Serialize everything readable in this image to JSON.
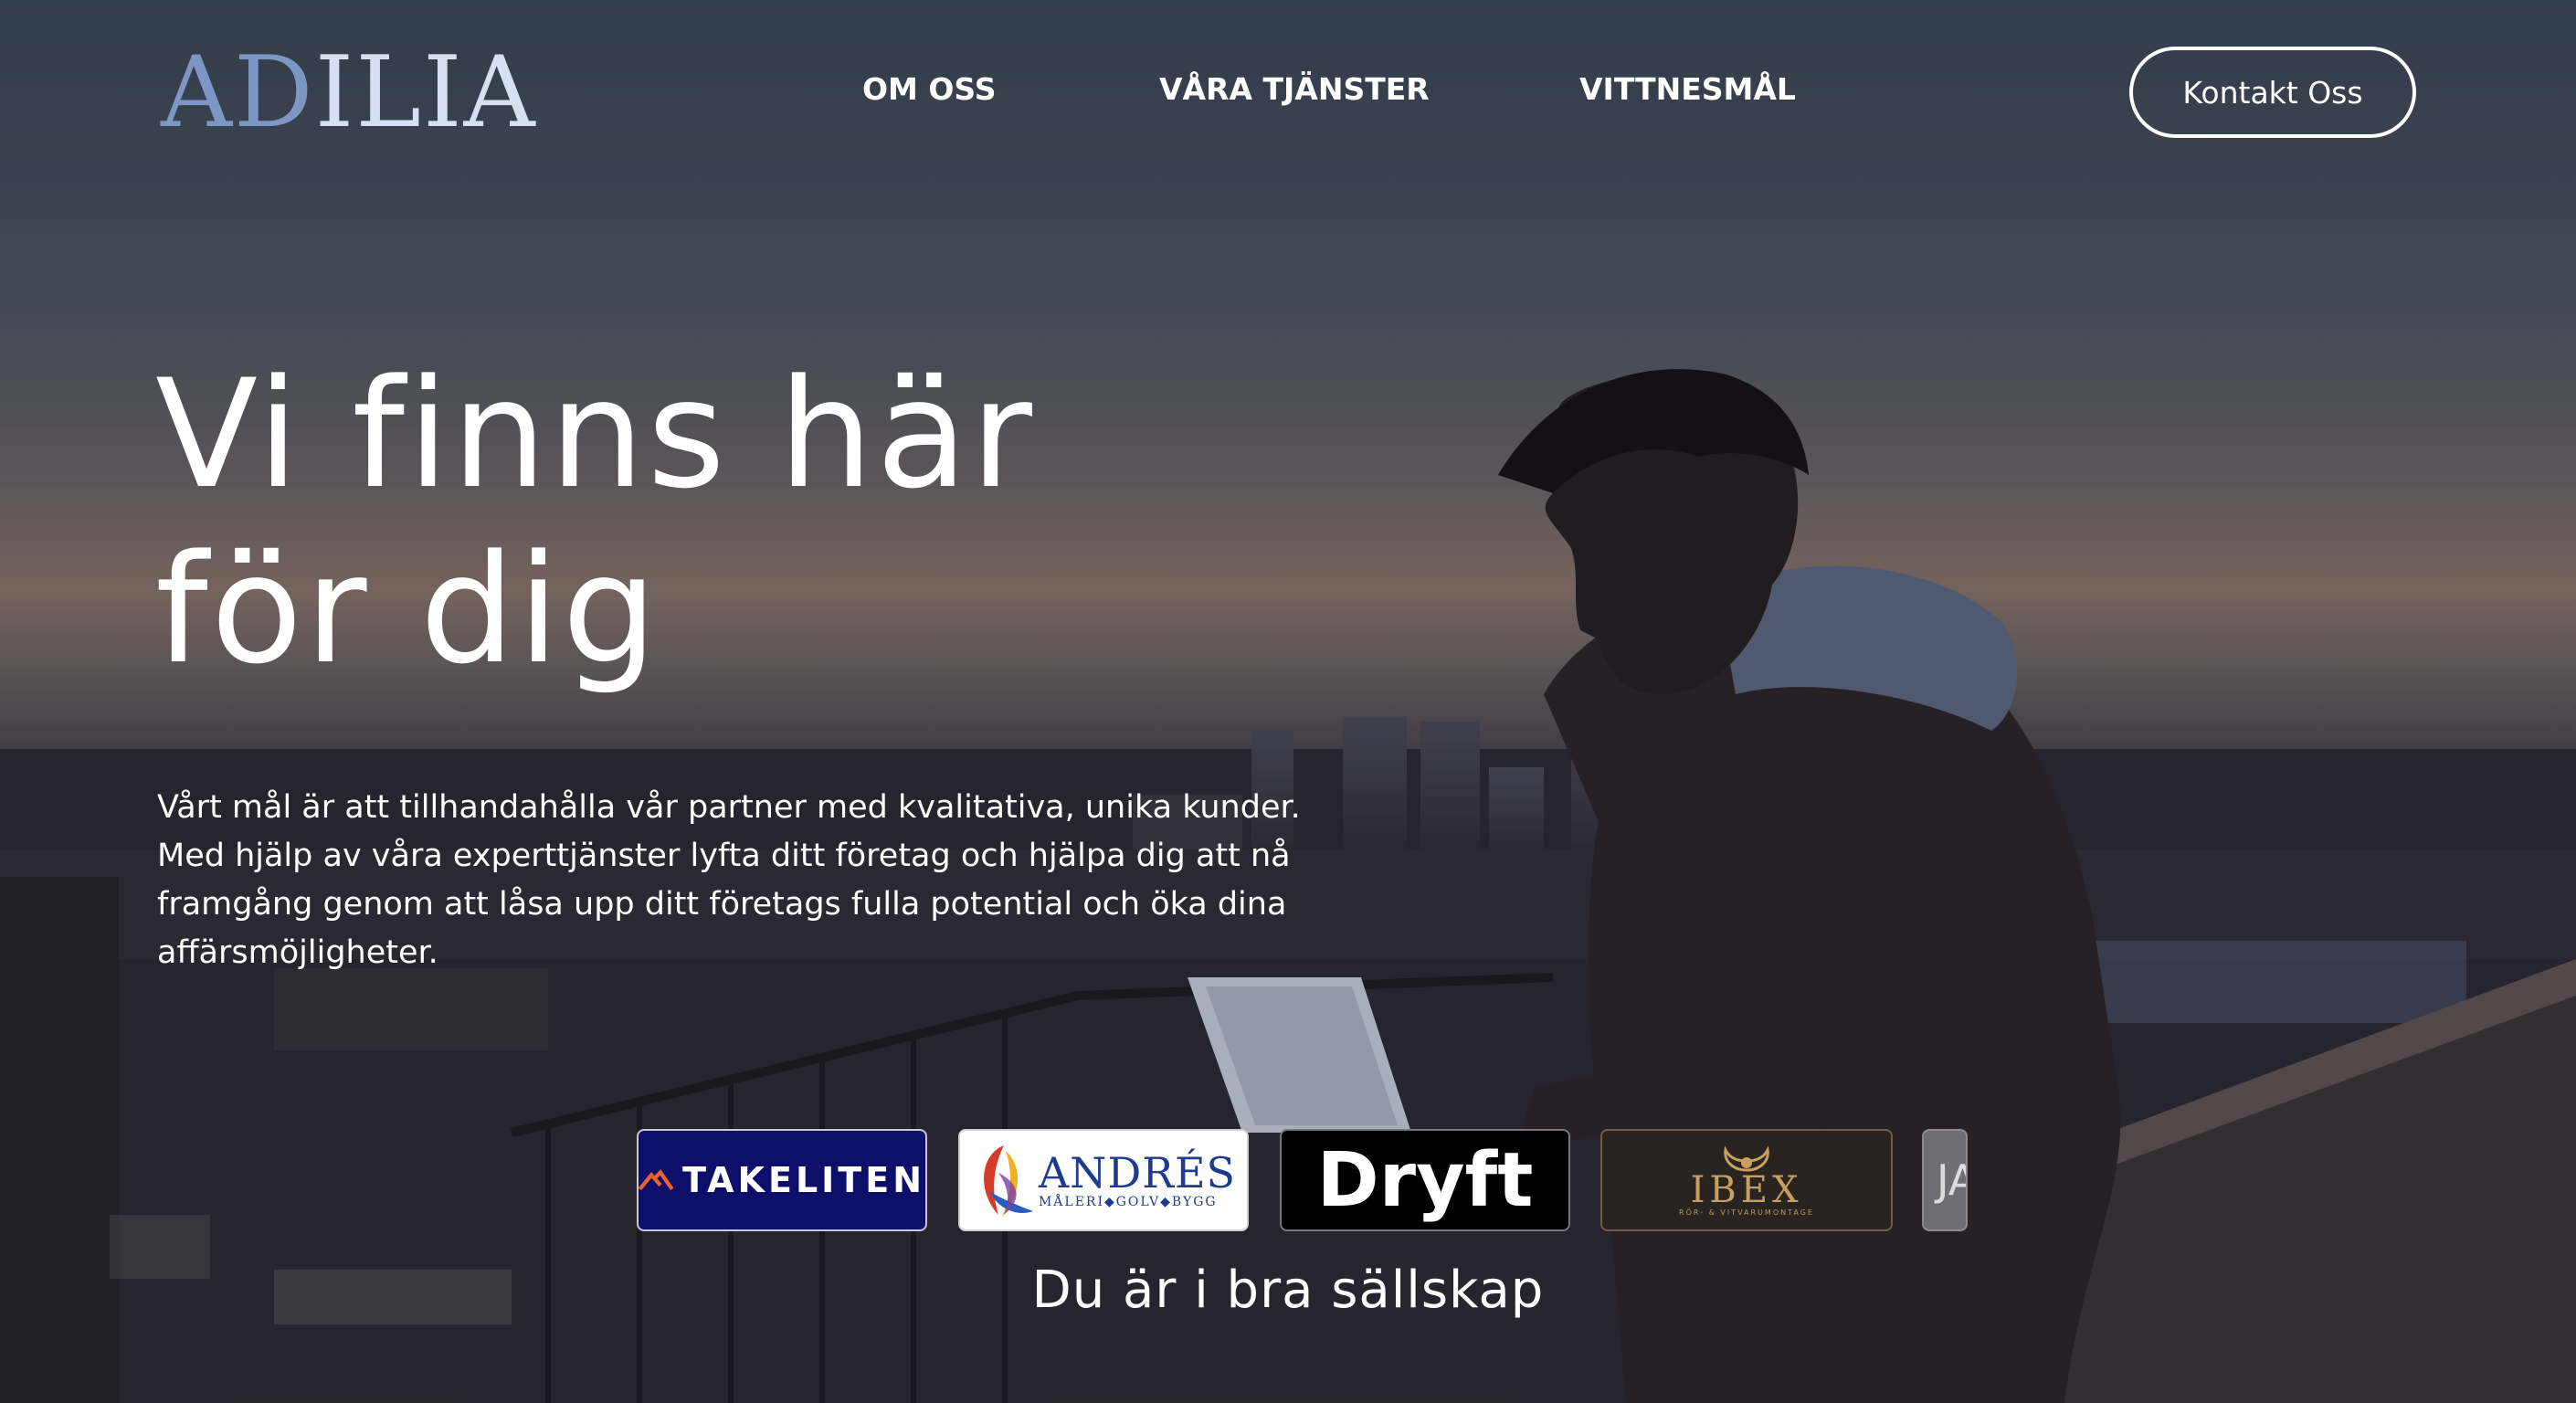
{
  "brand": {
    "logo_part1": "AD",
    "logo_part2": "ILIA"
  },
  "nav": {
    "items": [
      "OM OSS",
      "VÅRA TJÄNSTER",
      "VITTNESMÅL"
    ],
    "contact_label": "Kontakt Oss"
  },
  "hero": {
    "headline_line1": "Vi finns här",
    "headline_line2": "för dig",
    "intro": "Vårt mål är att tillhandahålla vår partner med kvalitativa, unika kunder. Med hjälp av våra experttjänster lyfta ditt företag och hjälpa dig att nå framgång genom att låsa upp ditt företags fulla potential och öka dina affärsmöjligheter."
  },
  "partners": {
    "logos": [
      {
        "name": "TAKELITEN"
      },
      {
        "name": "ANDRÉS",
        "subtitle": "MÅLERI◆GOLV◆BYGG"
      },
      {
        "name": "Dryft"
      },
      {
        "name": "IBEX",
        "subtitle": "RÖR- & VITVARUMONTAGE"
      },
      {
        "name": "JA"
      }
    ],
    "tagline": "Du är i bra sällskap"
  },
  "colors": {
    "logo_accent": "#7d97c4",
    "takeliten_bg": "#0d0f6b",
    "takeliten_accent": "#e8612c",
    "ibex_gold": "#c9a060"
  }
}
